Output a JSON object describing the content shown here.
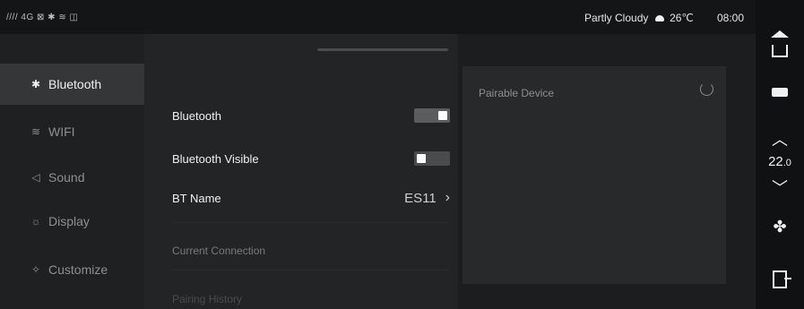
{
  "status_bar": {
    "left_indicators": "//// 4G ⊠ ✱ ≋ ◫",
    "weather": "Partly Cloudy",
    "temperature": "26℃",
    "time": "08:00"
  },
  "sidebar": {
    "items": [
      {
        "label": "Bluetooth",
        "icon": "bluetooth-icon",
        "glyph": "✱",
        "active": true
      },
      {
        "label": "WIFI",
        "icon": "wifi-icon",
        "glyph": "≋",
        "active": false
      },
      {
        "label": "Sound",
        "icon": "speaker-icon",
        "glyph": "◁",
        "active": false
      },
      {
        "label": "Display",
        "icon": "brightness-icon",
        "glyph": "☼",
        "active": false
      },
      {
        "label": "Customize",
        "icon": "customize-icon",
        "glyph": "✧",
        "active": false
      }
    ]
  },
  "settings": {
    "bluetooth_label": "Bluetooth",
    "bluetooth_on": true,
    "visible_label": "Bluetooth Visible",
    "visible_on": false,
    "bt_name_label": "BT Name",
    "bt_name_value": "ES11",
    "chevron": "›",
    "current_connection_title": "Current Connection",
    "pairing_history_title": "Pairing History"
  },
  "pair_panel": {
    "title": "Pairable Device"
  },
  "control_bar": {
    "up_glyph": "︿",
    "down_glyph": "﹀",
    "temp_int": "22",
    "temp_dec": ".0",
    "fan_glyph": "✤"
  },
  "colors": {
    "background": "#1c1d1f",
    "active_item": "#353638",
    "panel": "#28292b",
    "toggle_knob": "#ffffff"
  }
}
